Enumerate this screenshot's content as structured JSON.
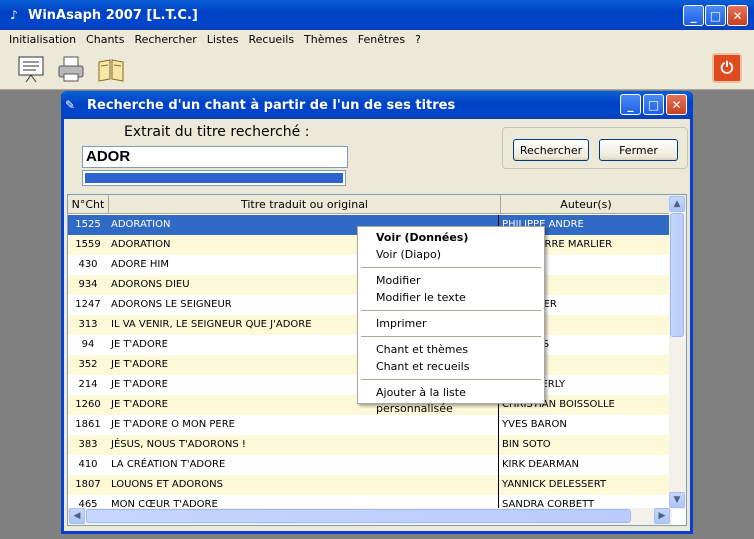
{
  "window": {
    "title": "WinAsaph 2007 [L.T.C.]"
  },
  "menu": [
    "Initialisation",
    "Chants",
    "Rechercher",
    "Listes",
    "Recueils",
    "Thèmes",
    "Fenêtres",
    "?"
  ],
  "toolbar": {
    "icons": [
      "presentation-icon",
      "printer-icon",
      "book-icon"
    ],
    "poweroff_icon": "power-icon"
  },
  "dialog": {
    "title": "Recherche d'un chant à partir de l'un de ses titres",
    "search_label": "Extrait du titre recherché :",
    "search_value": "ADOR",
    "progress": 1.0,
    "search_button": "Rechercher",
    "close_button": "Fermer"
  },
  "table": {
    "columns": [
      "N°Cht",
      "Titre traduit ou original",
      "Auteur(s)"
    ],
    "rows": [
      [
        "1525",
        "ADORATION",
        "PHILIPPE ANDRE"
      ],
      [
        "1559",
        "ADORATION",
        "JEAN-PIERRE MARLIER"
      ],
      [
        "430",
        "ADORE HIM",
        ""
      ],
      [
        "934",
        "ADORONS DIEU",
        "...TSON"
      ],
      [
        "1247",
        "ADORONS LE SEIGNEUR",
        "...HNEIDER"
      ],
      [
        "313",
        "IL VA VENIR, LE SEIGNEUR QUE J'ADORE",
        "...BRIEL"
      ],
      [
        "94",
        "JE T'ADORE",
        "...HARRIS"
      ],
      [
        "352",
        "JE T'ADORE",
        "...TTLE"
      ],
      [
        "214",
        "JE T'ADORE",
        "...PHE BERLY"
      ],
      [
        "1260",
        "JE T'ADORE",
        "CHRISTIAN BOISSOLLE"
      ],
      [
        "1861",
        "JE T'ADORE O MON PERE",
        "YVES BARON"
      ],
      [
        "383",
        "JÉSUS, NOUS T'ADORONS !",
        "BIN SOTO"
      ],
      [
        "410",
        "LA CRÉATION T'ADORE",
        "KIRK DEARMAN"
      ],
      [
        "1807",
        "LOUONS ET ADORONS",
        "YANNICK DELESSERT"
      ],
      [
        "465",
        "MON CŒUR T'ADORE",
        "SANDRA CORBETT"
      ]
    ]
  },
  "context_menu": {
    "items": [
      "Voir (Données)",
      "Voir (Diapo)",
      "Modifier",
      "Modifier le texte",
      "Imprimer",
      "Chant et thèmes",
      "Chant et recueils",
      "Ajouter à la liste personnalisée"
    ]
  }
}
